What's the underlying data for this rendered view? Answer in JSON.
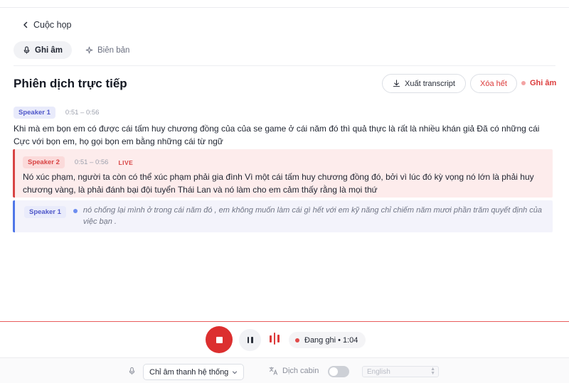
{
  "nav": {
    "back_label": "Cuộc họp"
  },
  "modes": {
    "record_label": "Ghi âm",
    "minutes_label": "Biên bản"
  },
  "header": {
    "title": "Phiên dịch trực tiếp",
    "export_label": "Xuất transcript",
    "clear_label": "Xóa hết",
    "record_status": "Ghi âm"
  },
  "transcript": {
    "seg1": {
      "speaker": "Speaker 1",
      "time": "0:51 – 0:56",
      "text": "Khi mà em bọn em có được cái tấm huy chương đồng của của se game ở cái năm đó thì quả thực là rất là nhiều khán giả Đã có những cái Cực với bọn em, họ gọi bọn em bằng những cái từ ngữ"
    },
    "seg2": {
      "speaker": "Speaker 2",
      "time": "0:51 – 0:56",
      "live": "LIVE",
      "text": "Nó xúc phạm, người ta còn có thể xúc phạm phải gia đình Vì một cái tấm huy chương đồng đó, bởi vì lúc đó kỳ vọng nó lớn là phải huy chương vàng, là phải đánh bại đội tuyển Thái Lan và nó làm cho em cảm thấy rằng là mọi thứ"
    },
    "seg3": {
      "speaker": "Speaker 1",
      "text": "nó chống lại mình ở trong cái năm đó , em không muốn làm cái gì hết với em kỹ năng chỉ chiếm năm mươi phần trăm quyết định của việc bạn ."
    }
  },
  "controls": {
    "status": "Đang ghi • 1:04",
    "audio_source": "Chỉ âm thanh hệ thống",
    "cabin_label": "Dịch cabin",
    "cabin_enabled": false,
    "language": "English"
  },
  "colors": {
    "accent_red": "#dc2f2f",
    "speaker1": "#4f57c9",
    "speaker2": "#d84444"
  },
  "icons": [
    "chevron-left-icon",
    "mic-icon",
    "sparkle-icon",
    "download-icon",
    "stop-icon",
    "pause-icon",
    "audio-level-icon",
    "translate-icon",
    "chevron-down-icon"
  ]
}
